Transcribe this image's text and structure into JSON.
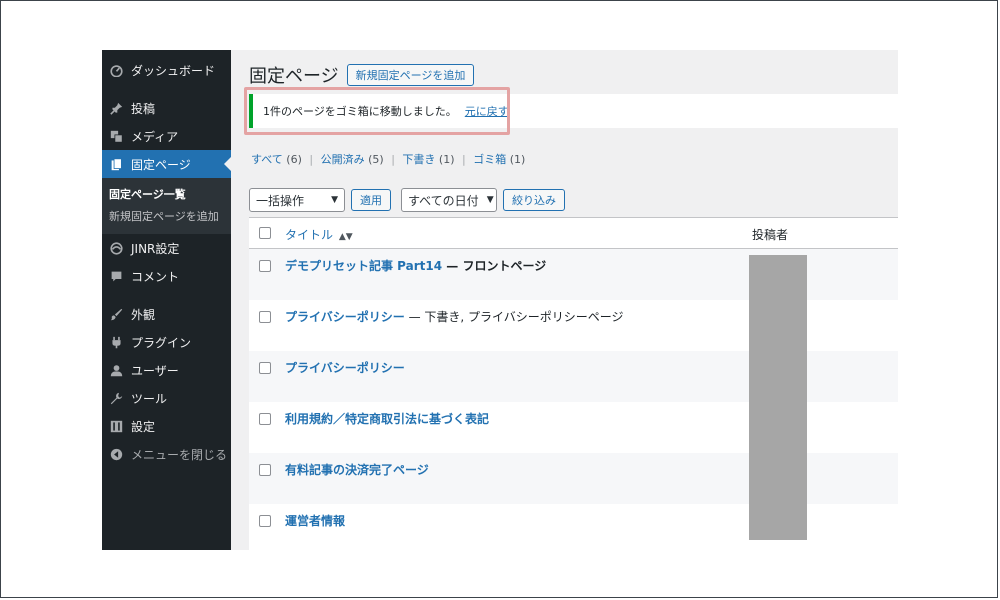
{
  "sidebar": {
    "items": [
      {
        "label": "ダッシュボード",
        "icon": "dashboard-icon"
      },
      {
        "label": "投稿",
        "icon": "pin-icon"
      },
      {
        "label": "メディア",
        "icon": "media-icon"
      },
      {
        "label": "固定ページ",
        "icon": "pages-icon",
        "current": true
      },
      {
        "label": "JINR設定",
        "icon": "settings-swirl-icon"
      },
      {
        "label": "コメント",
        "icon": "comment-icon"
      },
      {
        "label": "外観",
        "icon": "brush-icon"
      },
      {
        "label": "プラグイン",
        "icon": "plugin-icon"
      },
      {
        "label": "ユーザー",
        "icon": "user-icon"
      },
      {
        "label": "ツール",
        "icon": "wrench-icon"
      },
      {
        "label": "設定",
        "icon": "settings-icon"
      }
    ],
    "submenu": [
      "固定ページ一覧",
      "新規固定ページを追加"
    ],
    "collapse_label": "メニューを閉じる"
  },
  "header": {
    "title": "固定ページ",
    "add_new_label": "新規固定ページを追加"
  },
  "notice": {
    "message": "1件のページをゴミ箱に移動しました。",
    "undo_label": "元に戻す",
    "accent_color": "#00a32a"
  },
  "filters": [
    {
      "label": "すべて",
      "count": "(6)"
    },
    {
      "label": "公開済み",
      "count": "(5)"
    },
    {
      "label": "下書き",
      "count": "(1)"
    },
    {
      "label": "ゴミ箱",
      "count": "(1)"
    }
  ],
  "tablenav": {
    "bulk_action": "一括操作",
    "apply_label": "適用",
    "date_filter": "すべての日付",
    "filter_label": "絞り込み"
  },
  "table": {
    "columns": {
      "title": "タイトル",
      "author": "投稿者"
    },
    "rows": [
      {
        "title": "デモプリセット記事 Part14",
        "state": " — フロントページ"
      },
      {
        "title": "プライバシーポリシー",
        "state": " — 下書き, プライバシーポリシーページ"
      },
      {
        "title": "プライバシーポリシー",
        "state": ""
      },
      {
        "title": "利用規約／特定商取引法に基づく表記",
        "state": ""
      },
      {
        "title": "有料記事の決済完了ページ",
        "state": ""
      },
      {
        "title": "運営者情報",
        "state": ""
      }
    ]
  },
  "colors": {
    "sidebar_bg": "#1d2327",
    "accent": "#2271b1",
    "highlight_box": "#e4a3a3"
  }
}
